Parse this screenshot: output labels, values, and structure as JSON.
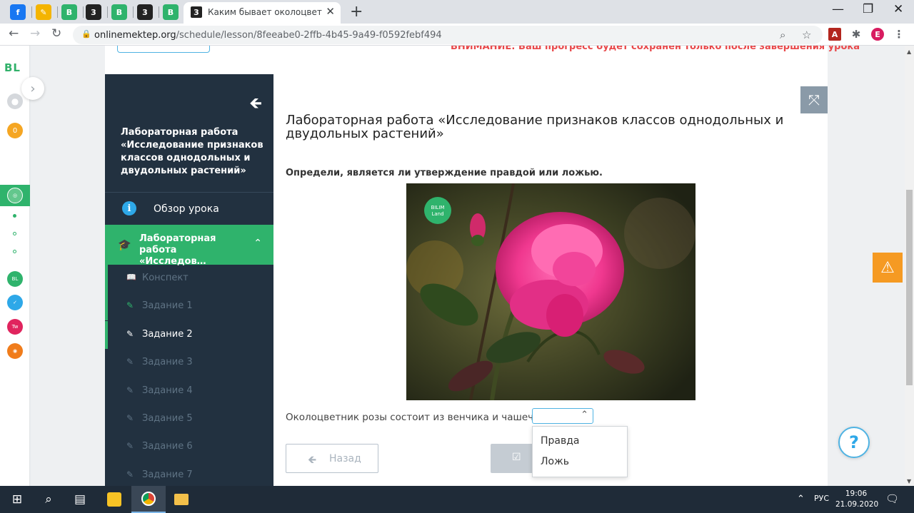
{
  "browser": {
    "active_tab_title": "Каким бывает околоцветник по",
    "url_host": "onlinemektep.org",
    "url_path": "/schedule/lesson/8feeabe0-2ffb-4b45-9a49-f0592febf494",
    "profile_initial": "E",
    "pinned_tabs": [
      {
        "label": "f",
        "color": "#1877f2"
      },
      {
        "label": "✎",
        "color": "#f4b400"
      },
      {
        "label": "B",
        "color": "#2fb36c"
      },
      {
        "label": "3",
        "color": "#222222"
      },
      {
        "label": "B",
        "color": "#2fb36c"
      },
      {
        "label": "3",
        "color": "#222222"
      },
      {
        "label": "B",
        "color": "#2fb36c"
      }
    ]
  },
  "rail": {
    "logo": "BL",
    "badge_count": "0"
  },
  "header": {
    "warning": "ВНИМАНИЕ: Ваш прогресс будет сохранен только после завершения урока"
  },
  "sidebar": {
    "title": "Лабораторная работа «Исследование признаков классов однодольных и двудольных растений»",
    "overview_label": "Обзор урока",
    "current_section": "Лабораторная работа «Исследов…",
    "items": [
      {
        "label": "Конспект",
        "state": "done"
      },
      {
        "label": "Задание 1",
        "state": "done"
      },
      {
        "label": "Задание 2",
        "state": "active"
      },
      {
        "label": "Задание 3",
        "state": "pending"
      },
      {
        "label": "Задание 4",
        "state": "pending"
      },
      {
        "label": "Задание 5",
        "state": "pending"
      },
      {
        "label": "Задание 6",
        "state": "pending"
      },
      {
        "label": "Задание 7",
        "state": "pending"
      }
    ]
  },
  "main": {
    "title": "Лабораторная работа «Исследование признаков классов однодольных и двудольных растений»",
    "instruction": "Определи, является ли утверждение правдой или ложью.",
    "image_watermark_1": "BILIM",
    "image_watermark_2": "Land",
    "question": "Околоцветник розы состоит из венчика и чашечки.",
    "select_value": "",
    "options": [
      "Правда",
      "Ложь"
    ],
    "back_label": "Назад"
  },
  "taskbar": {
    "language": "РУС",
    "time": "19:06",
    "date": "21.09.2020"
  },
  "colors": {
    "accent_green": "#2fb36c",
    "sidebar_bg": "#223140",
    "warning_red": "#e8484a",
    "alert_orange": "#f59a23",
    "link_blue": "#4fb3e3"
  }
}
